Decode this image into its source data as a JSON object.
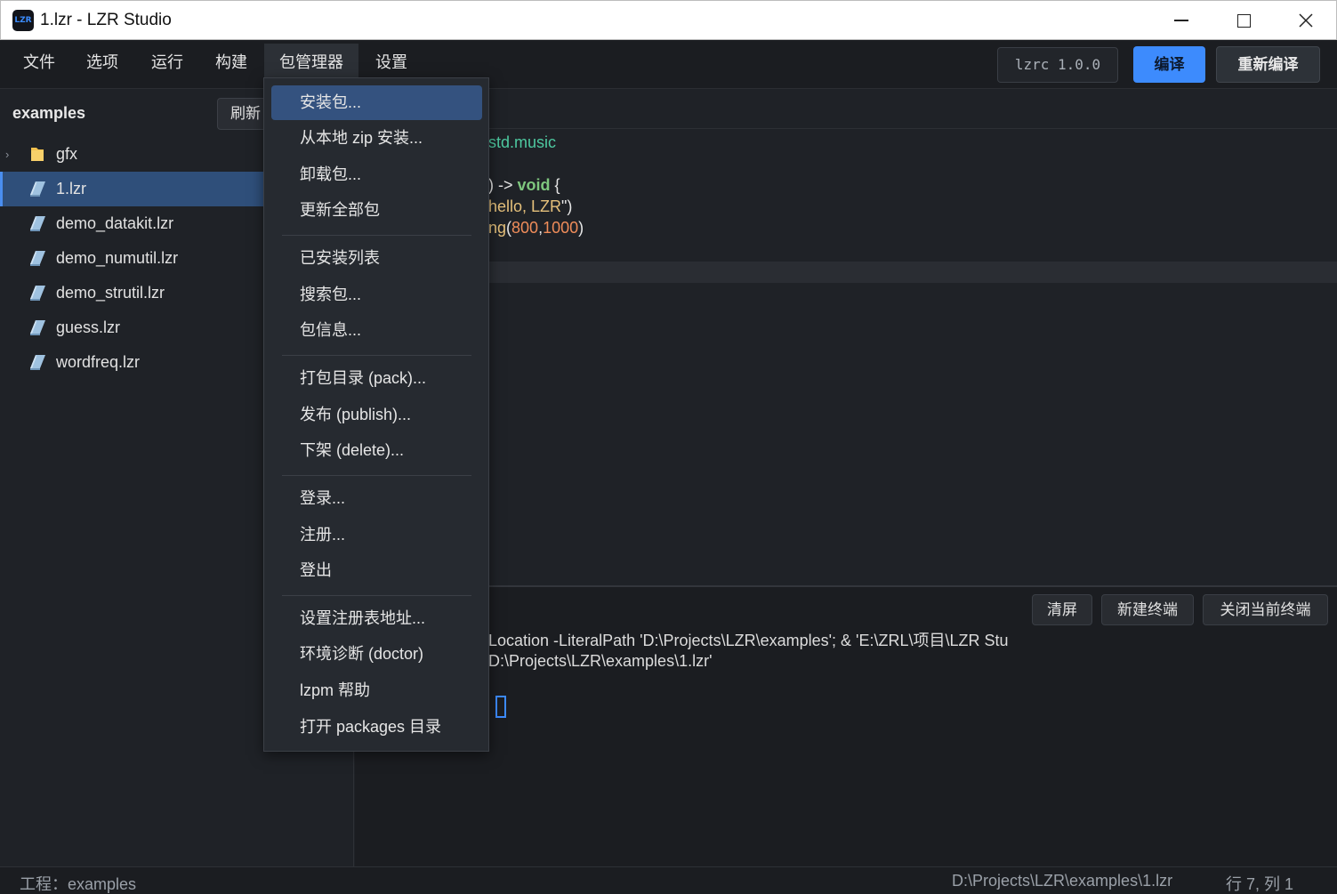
{
  "window": {
    "title": "1.lzr - LZR Studio",
    "app_icon_text": "LZR"
  },
  "menubar": {
    "items": [
      "文件",
      "选项",
      "运行",
      "构建",
      "包管理器",
      "设置"
    ],
    "active_item": "包管理器",
    "version_label": "lzrc 1.0.0",
    "compile_label": "编译",
    "recompile_label": "重新编译"
  },
  "sidebar": {
    "title": "examples",
    "refresh_label": "刷新",
    "tree": [
      {
        "label": "gfx",
        "type": "folder",
        "icon": "folder-icon"
      },
      {
        "label": "1.lzr",
        "type": "file",
        "icon": "file-icon",
        "selected": true
      },
      {
        "label": "demo_datakit.lzr",
        "type": "file",
        "icon": "file-icon"
      },
      {
        "label": "demo_numutil.lzr",
        "type": "file",
        "icon": "file-icon"
      },
      {
        "label": "demo_strutil.lzr",
        "type": "file",
        "icon": "file-icon"
      },
      {
        "label": "guess.lzr",
        "type": "file",
        "icon": "file-icon"
      },
      {
        "label": "wordfreq.lzr",
        "type": "file",
        "icon": "file-icon"
      }
    ]
  },
  "editor": {
    "lines": [
      {
        "parts": [
          {
            "t": "std.music",
            "c": "green"
          }
        ]
      },
      {
        "parts": []
      },
      {
        "parts": [
          {
            "t": ") -> ",
            "c": "white"
          },
          {
            "t": "void",
            "c": "kw"
          },
          {
            "t": " {",
            "c": "white"
          }
        ]
      },
      {
        "parts": [
          {
            "t": "hello, LZR",
            "c": "yellow"
          },
          {
            "t": "\")",
            "c": "white"
          }
        ]
      },
      {
        "parts": [
          {
            "t": "ng",
            "c": "yellow"
          },
          {
            "t": "(",
            "c": "white"
          },
          {
            "t": "800",
            "c": "orange"
          },
          {
            "t": ",",
            "c": "white"
          },
          {
            "t": "1000",
            "c": "orange"
          },
          {
            "t": ")",
            "c": "white"
          }
        ]
      }
    ]
  },
  "terminal": {
    "buttons": [
      "清屏",
      "新建终端",
      "关闭当前终端"
    ],
    "lines": [
      "Location -LiteralPath 'D:\\Projects\\LZR\\examples'; & 'E:\\ZRL\\项目\\LZR Stu",
      "D:\\Projects\\LZR\\examples\\1.lzr'"
    ]
  },
  "statusbar": {
    "project": "工程：examples",
    "path": "D:\\Projects\\LZR\\examples\\1.lzr",
    "position": "行 7, 列 1"
  },
  "dropdown": {
    "groups": [
      [
        "安装包...",
        "从本地 zip 安装...",
        "卸载包...",
        "更新全部包"
      ],
      [
        "已安装列表",
        "搜索包...",
        "包信息..."
      ],
      [
        "打包目录 (pack)...",
        "发布 (publish)...",
        "下架 (delete)..."
      ],
      [
        "登录...",
        "注册...",
        "登出"
      ],
      [
        "设置注册表地址...",
        "环境诊断 (doctor)",
        "lzpm 帮助",
        "打开 packages 目录"
      ]
    ],
    "highlighted": "安装包..."
  },
  "colors": {
    "accent": "#3d8bfd",
    "selection": "#2f4f7a",
    "menu_hover": "#34527f",
    "code_green": "#4ec9a0",
    "code_yellow": "#e5c07b",
    "code_orange": "#f08d5a"
  }
}
